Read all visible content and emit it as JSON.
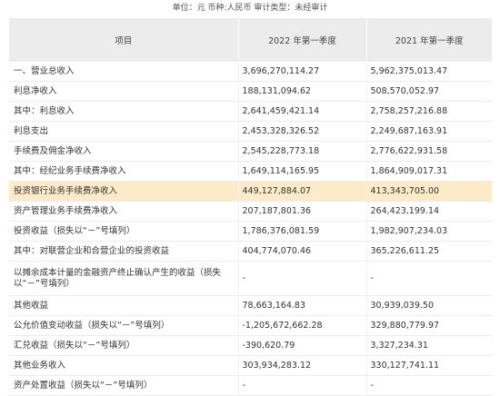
{
  "meta": {
    "text": "单位：元 币种:人民币 审计类型：未经审计"
  },
  "columns": {
    "item": "项目",
    "q1_2022": "2022 年第一季度",
    "q1_2021": "2021 年第一季度"
  },
  "rows": [
    {
      "label": "一、营业总收入",
      "v2022": "3,696,270,114.27",
      "v2021": "5,962,375,013.47"
    },
    {
      "label": "利息净收入",
      "v2022": "188,131,094.62",
      "v2021": "508,570,052.97"
    },
    {
      "label": "其中：利息收入",
      "v2022": "2,641,459,421.14",
      "v2021": "2,758,257,216.88"
    },
    {
      "label": "利息支出",
      "v2022": "2,453,328,326.52",
      "v2021": "2,249,687,163.91"
    },
    {
      "label": "手续费及佣金净收入",
      "v2022": "2,545,228,773.18",
      "v2021": "2,776,622,931.58"
    },
    {
      "label": "其中：经纪业务手续费净收入",
      "v2022": "1,649,114,165.95",
      "v2021": "1,864,909,017.31"
    },
    {
      "label": "投资银行业务手续费净收入",
      "v2022": "449,127,884.07",
      "v2021": "413,343,705.00"
    },
    {
      "label": "资产管理业务手续费净收入",
      "v2022": "207,187,801.36",
      "v2021": "264,423,199.14"
    },
    {
      "label": "投资收益（损失以“－”号填列）",
      "v2022": "1,786,376,081.59",
      "v2021": "1,982,907,234.03"
    },
    {
      "label": "其中：对联营企业和合营企业的投资收益",
      "v2022": "404,774,070.46",
      "v2021": "365,226,611.25"
    },
    {
      "label": "以摊余成本计量的金融资产终止确认产生的收益（损失以“－”号填列）",
      "v2022": "-",
      "v2021": "-"
    },
    {
      "label": "其他收益",
      "v2022": "78,663,164.83",
      "v2021": "30,939,039.50"
    },
    {
      "label": "公允价值变动收益（损失以“－”号填列）",
      "v2022": "-1,205,672,662.28",
      "v2021": "329,880,779.97"
    },
    {
      "label": "汇兑收益（损失以“－”号填列）",
      "v2022": "-390,620.79",
      "v2021": "3,327,234.31"
    },
    {
      "label": "其他业务收入",
      "v2022": "303,934,283.12",
      "v2021": "330,127,741.11"
    },
    {
      "label": "资产处置收益（损失以“－”号填列）",
      "v2022": "-",
      "v2021": "-"
    }
  ],
  "icons": {
    "copy": "copy-icon"
  },
  "colors": {
    "header_bg": "#ececec",
    "highlight_bg": "#fdebc8",
    "border": "#ececec"
  }
}
